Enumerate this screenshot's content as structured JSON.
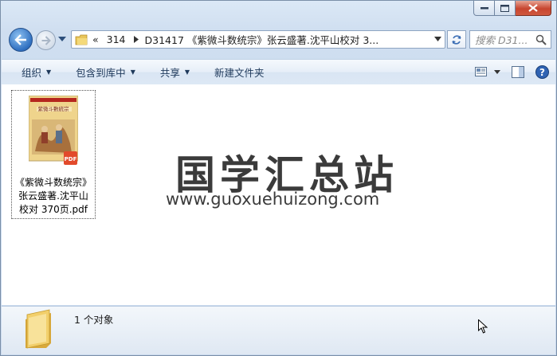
{
  "nav": {
    "address_segments": [
      "«",
      "314",
      "D31417 《紫微斗数统宗》张云盛著.沈平山校对 3..."
    ],
    "search_placeholder": "搜索 D31..."
  },
  "toolbar": {
    "organize": "组织",
    "include_library": "包含到库中",
    "share": "共享",
    "new_folder": "新建文件夹"
  },
  "file": {
    "name": "《紫微斗数统宗》张云盛著.沈平山校对 370页.pdf",
    "name_lines": [
      "《紫微斗数统宗》",
      "张云盛著.沈平山",
      "校对 370页.pdf"
    ],
    "thumb_title": "紫微斗數統宗",
    "badge": "PDF"
  },
  "watermark": {
    "title": "国学汇总站",
    "url": "www.guoxuehuizong.com"
  },
  "status": {
    "count": "1 个对象"
  },
  "colors": {
    "pdf_badge": "#e24a2b",
    "cover_yellow": "#efd48c",
    "cover_red": "#b5261e"
  }
}
